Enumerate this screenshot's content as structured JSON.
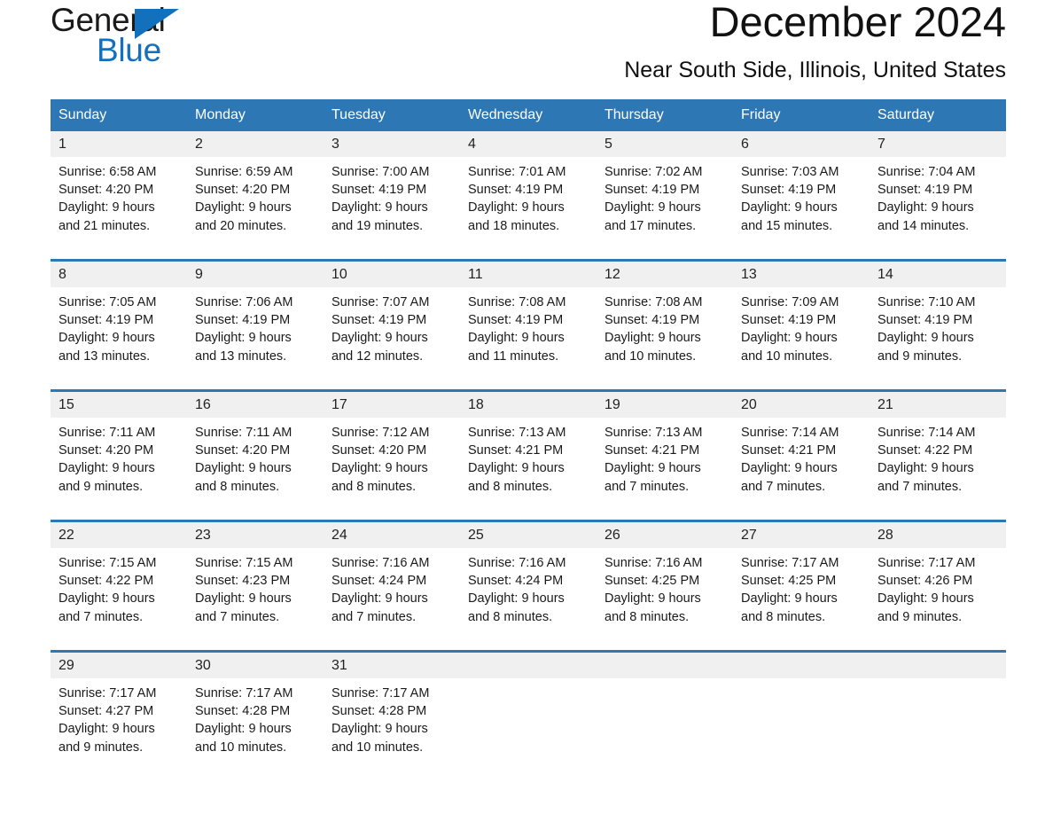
{
  "brand": {
    "name_part1": "General",
    "name_part2": "Blue",
    "logo_icon": "triangle-icon",
    "accent_color": "#1270bd"
  },
  "header": {
    "month_title": "December 2024",
    "location": "Near South Side, Illinois, United States"
  },
  "colors": {
    "header_blue": "#2e77b5",
    "daynum_gray": "#f0f0f0",
    "text": "#1a1a1a"
  },
  "calendar": {
    "weekday_headers": [
      "Sunday",
      "Monday",
      "Tuesday",
      "Wednesday",
      "Thursday",
      "Friday",
      "Saturday"
    ],
    "weeks": [
      {
        "days": [
          {
            "date": "1",
            "sunrise": "Sunrise: 6:58 AM",
            "sunset": "Sunset: 4:20 PM",
            "daylight_line1": "Daylight: 9 hours",
            "daylight_line2": "and 21 minutes."
          },
          {
            "date": "2",
            "sunrise": "Sunrise: 6:59 AM",
            "sunset": "Sunset: 4:20 PM",
            "daylight_line1": "Daylight: 9 hours",
            "daylight_line2": "and 20 minutes."
          },
          {
            "date": "3",
            "sunrise": "Sunrise: 7:00 AM",
            "sunset": "Sunset: 4:19 PM",
            "daylight_line1": "Daylight: 9 hours",
            "daylight_line2": "and 19 minutes."
          },
          {
            "date": "4",
            "sunrise": "Sunrise: 7:01 AM",
            "sunset": "Sunset: 4:19 PM",
            "daylight_line1": "Daylight: 9 hours",
            "daylight_line2": "and 18 minutes."
          },
          {
            "date": "5",
            "sunrise": "Sunrise: 7:02 AM",
            "sunset": "Sunset: 4:19 PM",
            "daylight_line1": "Daylight: 9 hours",
            "daylight_line2": "and 17 minutes."
          },
          {
            "date": "6",
            "sunrise": "Sunrise: 7:03 AM",
            "sunset": "Sunset: 4:19 PM",
            "daylight_line1": "Daylight: 9 hours",
            "daylight_line2": "and 15 minutes."
          },
          {
            "date": "7",
            "sunrise": "Sunrise: 7:04 AM",
            "sunset": "Sunset: 4:19 PM",
            "daylight_line1": "Daylight: 9 hours",
            "daylight_line2": "and 14 minutes."
          }
        ]
      },
      {
        "days": [
          {
            "date": "8",
            "sunrise": "Sunrise: 7:05 AM",
            "sunset": "Sunset: 4:19 PM",
            "daylight_line1": "Daylight: 9 hours",
            "daylight_line2": "and 13 minutes."
          },
          {
            "date": "9",
            "sunrise": "Sunrise: 7:06 AM",
            "sunset": "Sunset: 4:19 PM",
            "daylight_line1": "Daylight: 9 hours",
            "daylight_line2": "and 13 minutes."
          },
          {
            "date": "10",
            "sunrise": "Sunrise: 7:07 AM",
            "sunset": "Sunset: 4:19 PM",
            "daylight_line1": "Daylight: 9 hours",
            "daylight_line2": "and 12 minutes."
          },
          {
            "date": "11",
            "sunrise": "Sunrise: 7:08 AM",
            "sunset": "Sunset: 4:19 PM",
            "daylight_line1": "Daylight: 9 hours",
            "daylight_line2": "and 11 minutes."
          },
          {
            "date": "12",
            "sunrise": "Sunrise: 7:08 AM",
            "sunset": "Sunset: 4:19 PM",
            "daylight_line1": "Daylight: 9 hours",
            "daylight_line2": "and 10 minutes."
          },
          {
            "date": "13",
            "sunrise": "Sunrise: 7:09 AM",
            "sunset": "Sunset: 4:19 PM",
            "daylight_line1": "Daylight: 9 hours",
            "daylight_line2": "and 10 minutes."
          },
          {
            "date": "14",
            "sunrise": "Sunrise: 7:10 AM",
            "sunset": "Sunset: 4:19 PM",
            "daylight_line1": "Daylight: 9 hours",
            "daylight_line2": "and 9 minutes."
          }
        ]
      },
      {
        "days": [
          {
            "date": "15",
            "sunrise": "Sunrise: 7:11 AM",
            "sunset": "Sunset: 4:20 PM",
            "daylight_line1": "Daylight: 9 hours",
            "daylight_line2": "and 9 minutes."
          },
          {
            "date": "16",
            "sunrise": "Sunrise: 7:11 AM",
            "sunset": "Sunset: 4:20 PM",
            "daylight_line1": "Daylight: 9 hours",
            "daylight_line2": "and 8 minutes."
          },
          {
            "date": "17",
            "sunrise": "Sunrise: 7:12 AM",
            "sunset": "Sunset: 4:20 PM",
            "daylight_line1": "Daylight: 9 hours",
            "daylight_line2": "and 8 minutes."
          },
          {
            "date": "18",
            "sunrise": "Sunrise: 7:13 AM",
            "sunset": "Sunset: 4:21 PM",
            "daylight_line1": "Daylight: 9 hours",
            "daylight_line2": "and 8 minutes."
          },
          {
            "date": "19",
            "sunrise": "Sunrise: 7:13 AM",
            "sunset": "Sunset: 4:21 PM",
            "daylight_line1": "Daylight: 9 hours",
            "daylight_line2": "and 7 minutes."
          },
          {
            "date": "20",
            "sunrise": "Sunrise: 7:14 AM",
            "sunset": "Sunset: 4:21 PM",
            "daylight_line1": "Daylight: 9 hours",
            "daylight_line2": "and 7 minutes."
          },
          {
            "date": "21",
            "sunrise": "Sunrise: 7:14 AM",
            "sunset": "Sunset: 4:22 PM",
            "daylight_line1": "Daylight: 9 hours",
            "daylight_line2": "and 7 minutes."
          }
        ]
      },
      {
        "days": [
          {
            "date": "22",
            "sunrise": "Sunrise: 7:15 AM",
            "sunset": "Sunset: 4:22 PM",
            "daylight_line1": "Daylight: 9 hours",
            "daylight_line2": "and 7 minutes."
          },
          {
            "date": "23",
            "sunrise": "Sunrise: 7:15 AM",
            "sunset": "Sunset: 4:23 PM",
            "daylight_line1": "Daylight: 9 hours",
            "daylight_line2": "and 7 minutes."
          },
          {
            "date": "24",
            "sunrise": "Sunrise: 7:16 AM",
            "sunset": "Sunset: 4:24 PM",
            "daylight_line1": "Daylight: 9 hours",
            "daylight_line2": "and 7 minutes."
          },
          {
            "date": "25",
            "sunrise": "Sunrise: 7:16 AM",
            "sunset": "Sunset: 4:24 PM",
            "daylight_line1": "Daylight: 9 hours",
            "daylight_line2": "and 8 minutes."
          },
          {
            "date": "26",
            "sunrise": "Sunrise: 7:16 AM",
            "sunset": "Sunset: 4:25 PM",
            "daylight_line1": "Daylight: 9 hours",
            "daylight_line2": "and 8 minutes."
          },
          {
            "date": "27",
            "sunrise": "Sunrise: 7:17 AM",
            "sunset": "Sunset: 4:25 PM",
            "daylight_line1": "Daylight: 9 hours",
            "daylight_line2": "and 8 minutes."
          },
          {
            "date": "28",
            "sunrise": "Sunrise: 7:17 AM",
            "sunset": "Sunset: 4:26 PM",
            "daylight_line1": "Daylight: 9 hours",
            "daylight_line2": "and 9 minutes."
          }
        ]
      },
      {
        "days": [
          {
            "date": "29",
            "sunrise": "Sunrise: 7:17 AM",
            "sunset": "Sunset: 4:27 PM",
            "daylight_line1": "Daylight: 9 hours",
            "daylight_line2": "and 9 minutes."
          },
          {
            "date": "30",
            "sunrise": "Sunrise: 7:17 AM",
            "sunset": "Sunset: 4:28 PM",
            "daylight_line1": "Daylight: 9 hours",
            "daylight_line2": "and 10 minutes."
          },
          {
            "date": "31",
            "sunrise": "Sunrise: 7:17 AM",
            "sunset": "Sunset: 4:28 PM",
            "daylight_line1": "Daylight: 9 hours",
            "daylight_line2": "and 10 minutes."
          },
          {
            "date": "",
            "sunrise": "",
            "sunset": "",
            "daylight_line1": "",
            "daylight_line2": ""
          },
          {
            "date": "",
            "sunrise": "",
            "sunset": "",
            "daylight_line1": "",
            "daylight_line2": ""
          },
          {
            "date": "",
            "sunrise": "",
            "sunset": "",
            "daylight_line1": "",
            "daylight_line2": ""
          },
          {
            "date": "",
            "sunrise": "",
            "sunset": "",
            "daylight_line1": "",
            "daylight_line2": ""
          }
        ]
      }
    ]
  }
}
